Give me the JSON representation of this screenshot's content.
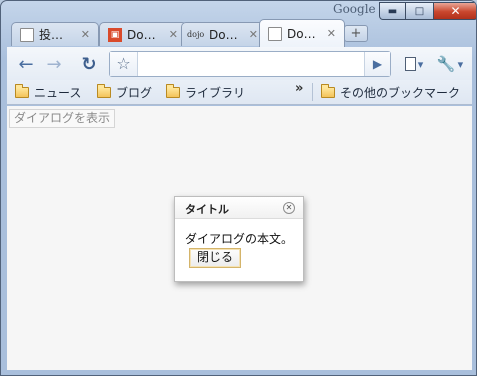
{
  "titlebar": {
    "brand": "Google",
    "minimize_glyph": "▬",
    "maximize_glyph": "□",
    "close_glyph": "✕"
  },
  "tabs": [
    {
      "label": "投…",
      "icon": "page-icon",
      "active": false
    },
    {
      "label": "Do…",
      "icon": "red-site-icon",
      "active": false
    },
    {
      "label": "Do…",
      "icon": "dojo-icon",
      "favicon_text": "dojo",
      "active": false
    },
    {
      "label": "Do…",
      "icon": "page-icon",
      "active": true
    }
  ],
  "tab_close_glyph": "✕",
  "new_tab_glyph": "+",
  "toolbar": {
    "back_glyph": "←",
    "forward_glyph": "→",
    "reload_glyph": "↻",
    "star_glyph": "☆",
    "go_glyph": "▶",
    "page_glyph": "▾",
    "wrench_glyph": "▾",
    "url_value": ""
  },
  "bookmarks": {
    "items": [
      "ニュース",
      "ブログ",
      "ライブラリ"
    ],
    "overflow": "»",
    "other": "その他のブックマーク"
  },
  "content": {
    "show_button": "ダイアログを表示",
    "dialog": {
      "title": "タイトル",
      "close_glyph": "✕",
      "body": "ダイアログの本文。",
      "button": "閉じる"
    }
  },
  "colors": {
    "frame": "#a9bfdc",
    "accent": "#4a6ea0",
    "close_red": "#c9462d"
  }
}
